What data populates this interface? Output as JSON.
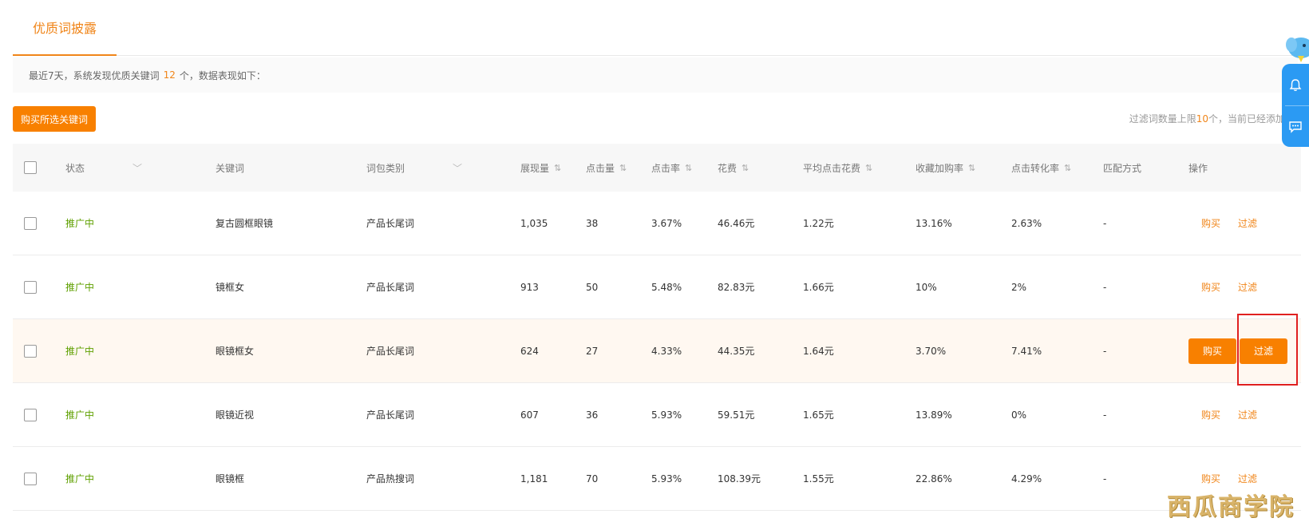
{
  "tab": {
    "label": "优质词披露"
  },
  "notice": {
    "prefix": "最近7天，系统发现优质关键词",
    "count": "12",
    "suffix": "个，数据表现如下："
  },
  "toolbar": {
    "buy_selected_label": "购买所选关键词",
    "filter_limit_prefix": "过滤词数量上限",
    "filter_limit_num": "10",
    "filter_limit_suffix": "个，当前已经添加"
  },
  "table": {
    "columns": {
      "status": "状态",
      "keyword": "关键词",
      "category": "词包类别",
      "impressions": "展现量",
      "clicks": "点击量",
      "ctr": "点击率",
      "cost": "花费",
      "avg_cpc": "平均点击花费",
      "fav_cart_rate": "收藏加购率",
      "conversion_rate": "点击转化率",
      "match_type": "匹配方式",
      "actions": "操作"
    },
    "sort_icon": "⇅",
    "rows": [
      {
        "status": "推广中",
        "keyword": "复古圆框眼镜",
        "category": "产品长尾词",
        "impressions": "1,035",
        "clicks": "38",
        "ctr": "3.67%",
        "cost": "46.46元",
        "avg_cpc": "1.22元",
        "fav_cart_rate": "13.16%",
        "conversion_rate": "2.63%",
        "match_type": "-",
        "buy": "购买",
        "filter": "过滤"
      },
      {
        "status": "推广中",
        "keyword": "镜框女",
        "category": "产品长尾词",
        "impressions": "913",
        "clicks": "50",
        "ctr": "5.48%",
        "cost": "82.83元",
        "avg_cpc": "1.66元",
        "fav_cart_rate": "10%",
        "conversion_rate": "2%",
        "match_type": "-",
        "buy": "购买",
        "filter": "过滤"
      },
      {
        "status": "推广中",
        "keyword": "眼镜框女",
        "category": "产品长尾词",
        "impressions": "624",
        "clicks": "27",
        "ctr": "4.33%",
        "cost": "44.35元",
        "avg_cpc": "1.64元",
        "fav_cart_rate": "3.70%",
        "conversion_rate": "7.41%",
        "match_type": "-",
        "buy": "购买",
        "filter": "过滤"
      },
      {
        "status": "推广中",
        "keyword": "眼镜近视",
        "category": "产品长尾词",
        "impressions": "607",
        "clicks": "36",
        "ctr": "5.93%",
        "cost": "59.51元",
        "avg_cpc": "1.65元",
        "fav_cart_rate": "13.89%",
        "conversion_rate": "0%",
        "match_type": "-",
        "buy": "购买",
        "filter": "过滤"
      },
      {
        "status": "推广中",
        "keyword": "眼镜框",
        "category": "产品热搜词",
        "impressions": "1,181",
        "clicks": "70",
        "ctr": "5.93%",
        "cost": "108.39元",
        "avg_cpc": "1.55元",
        "fav_cart_rate": "22.86%",
        "conversion_rate": "4.29%",
        "match_type": "-",
        "buy": "购买",
        "filter": "过滤"
      }
    ]
  },
  "watermark": "西瓜商学院",
  "colors": {
    "accent": "#f08519",
    "button": "#f88000",
    "status": "#5fa000",
    "highlight_row": "#fff8f1",
    "annotation": "#e02020",
    "float_panel": "#2b9af3"
  },
  "icons": {
    "bell": "bell-icon",
    "chat": "chat-icon",
    "caret": "chevron-down-icon",
    "mascot": "mascot-icon"
  }
}
